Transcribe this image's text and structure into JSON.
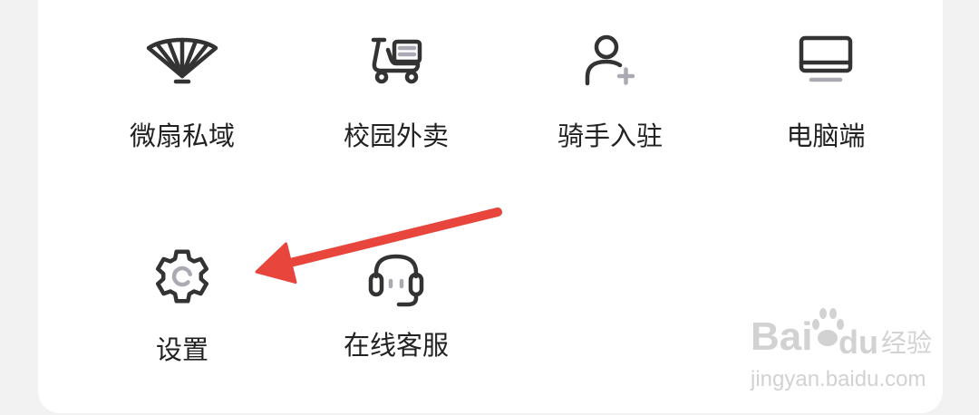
{
  "colors": {
    "background": "#f2f2f2",
    "card": "#ffffff",
    "icon_stroke": "#333333",
    "icon_accent": "#aaaab2",
    "label_text": "#222222",
    "annotation_arrow": "#e8453c"
  },
  "menu": {
    "items": [
      {
        "label": "微扇私域",
        "icon": "fan-icon"
      },
      {
        "label": "校园外卖",
        "icon": "scooter-icon"
      },
      {
        "label": "骑手入驻",
        "icon": "user-add-icon"
      },
      {
        "label": "电脑端",
        "icon": "monitor-icon"
      },
      {
        "label": "设置",
        "icon": "gear-icon"
      },
      {
        "label": "在线客服",
        "icon": "headset-icon"
      }
    ]
  },
  "watermark": {
    "logo_left": "Bai",
    "logo_right": "du",
    "logo_cn": "经验",
    "url": "jingyan.baidu.com"
  }
}
